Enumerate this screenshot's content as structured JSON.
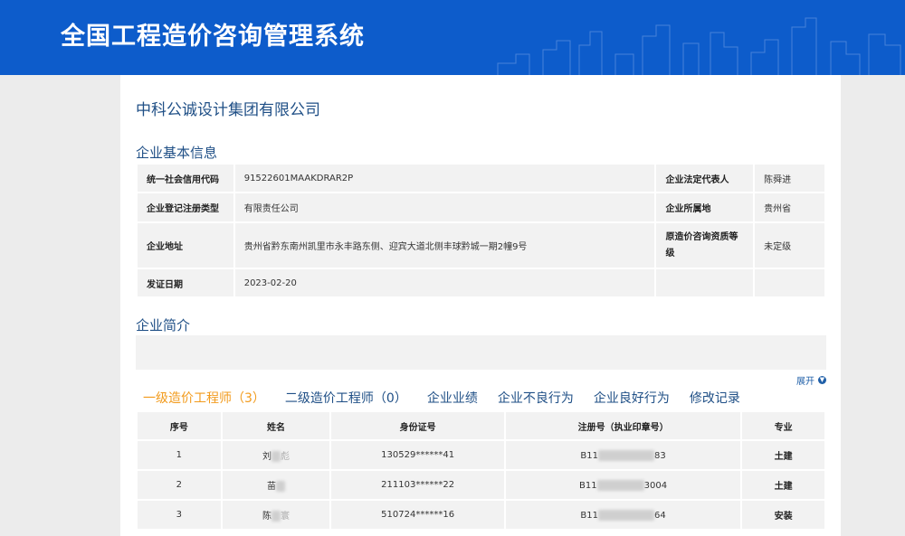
{
  "header": {
    "title": "全国工程造价咨询管理系统"
  },
  "company": {
    "name": "中科公诚设计集团有限公司"
  },
  "basic_info": {
    "title": "企业基本信息",
    "rows": [
      {
        "label1": "统一社会信用代码",
        "value1": "91522601MAAKDRAR2P",
        "label2": "企业法定代表人",
        "value2": "陈舜进"
      },
      {
        "label1": "企业登记注册类型",
        "value1": "有限责任公司",
        "label2": "企业所属地",
        "value2": "贵州省"
      },
      {
        "label1": "企业地址",
        "value1": "贵州省黔东南州凯里市永丰路东侧、迎宾大道北侧丰球黔城一期2幢9号",
        "label2": "原造价咨询资质等级",
        "value2": "未定级"
      },
      {
        "label1": "发证日期",
        "value1": "2023-02-20",
        "label2": "",
        "value2": ""
      }
    ]
  },
  "intro": {
    "title": "企业简介",
    "expand_label": "展开"
  },
  "tabs": [
    {
      "label": "一级造价工程师（3）",
      "active": true
    },
    {
      "label": "二级造价工程师（0）",
      "active": false
    },
    {
      "label": "企业业绩",
      "active": false
    },
    {
      "label": "企业不良行为",
      "active": false
    },
    {
      "label": "企业良好行为",
      "active": false
    },
    {
      "label": "修改记录",
      "active": false
    }
  ],
  "staff_table": {
    "headers": [
      "序号",
      "姓名",
      "身份证号",
      "注册号（执业印章号）",
      "专业"
    ],
    "rows": [
      {
        "index": "1",
        "name_visible": "刘",
        "name_tail": "彪",
        "id": "130529******41",
        "reg_prefix": "B11",
        "reg_suffix": "83",
        "major": "土建"
      },
      {
        "index": "2",
        "name_visible": "苗",
        "name_tail": "",
        "id": "211103******22",
        "reg_prefix": "B11",
        "reg_suffix": "3004",
        "major": "土建"
      },
      {
        "index": "3",
        "name_visible": "陈",
        "name_tail": "寰",
        "id": "510724******16",
        "reg_prefix": "B11",
        "reg_suffix": "64",
        "major": "安装"
      }
    ]
  }
}
